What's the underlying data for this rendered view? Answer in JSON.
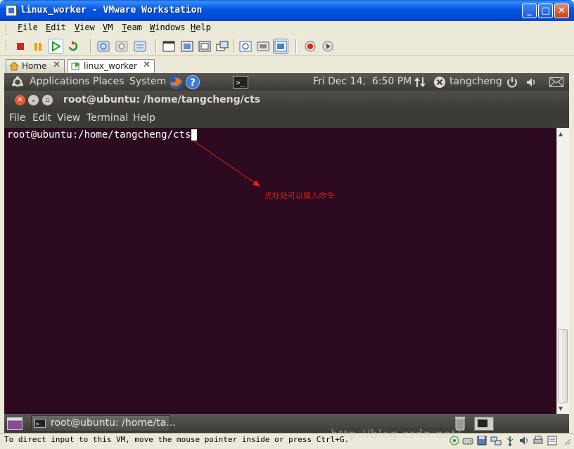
{
  "window": {
    "title": "linux_worker - VMware Workstation",
    "controls": [
      "minimize-icon",
      "maximize-icon",
      "close-icon"
    ]
  },
  "menu": {
    "items": [
      "File",
      "Edit",
      "View",
      "VM",
      "Team",
      "Windows",
      "Help"
    ]
  },
  "toolbar": {
    "icons": [
      "power-off-icon",
      "suspend-icon",
      "power-on-icon",
      "reset-icon",
      "snapshot-icon",
      "revert-snapshot-icon",
      "snapshot-manager-icon",
      "normal-view-icon",
      "full-screen-icon",
      "quick-switch-icon",
      "unity-icon",
      "summary-view-icon",
      "console-view-icon",
      "thumbnail-view-icon",
      "record-icon",
      "replay-icon"
    ]
  },
  "tabs": [
    {
      "label": "Home",
      "active": false
    },
    {
      "label": "linux_worker",
      "active": true
    }
  ],
  "guest": {
    "top_panel": {
      "menus": [
        "Applications",
        "Places",
        "System"
      ],
      "clock": "Fri Dec 14,  6:50 PM",
      "user": "tangcheng"
    },
    "terminal": {
      "title": "root@ubuntu: /home/tangcheng/cts",
      "menus": [
        "File",
        "Edit",
        "View",
        "Terminal",
        "Help"
      ],
      "prompt": "root@ubuntu:/home/tangcheng/cts# ",
      "background": "#2c0a1f"
    },
    "annotation": "光标处可以输入命令",
    "annotation_color": "#e21b1b",
    "bottom_panel": {
      "task": "root@ubuntu: /home/ta..."
    }
  },
  "status": {
    "text": "To direct input to this VM, move the mouse pointer inside or press Ctrl+G.",
    "watermark": "http://blog.csdn.net/"
  }
}
